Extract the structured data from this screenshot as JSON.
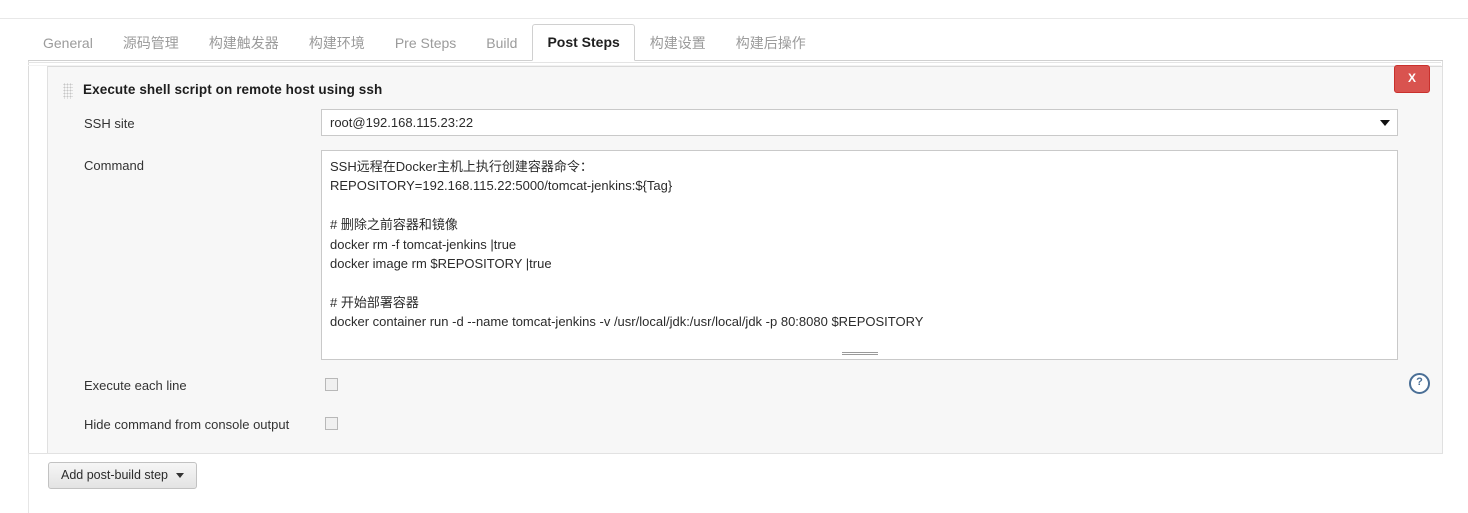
{
  "tabs": [
    {
      "label": "General",
      "active": false
    },
    {
      "label": "源码管理",
      "active": false
    },
    {
      "label": "构建触发器",
      "active": false
    },
    {
      "label": "构建环境",
      "active": false
    },
    {
      "label": "Pre Steps",
      "active": false
    },
    {
      "label": "Build",
      "active": false
    },
    {
      "label": "Post Steps",
      "active": true
    },
    {
      "label": "构建设置",
      "active": false
    },
    {
      "label": "构建后操作",
      "active": false
    }
  ],
  "step": {
    "title": "Execute shell script on remote host using ssh",
    "delete_label": "X",
    "drag_handle_icon": "drag-grip-icon",
    "help_icon": "help-circle-icon",
    "help_label": "?"
  },
  "fields": {
    "ssh_site": {
      "label": "SSH site",
      "value": "root@192.168.115.23:22",
      "caret_icon": "chevron-down-icon"
    },
    "command": {
      "label": "Command",
      "value": "SSH远程在Docker主机上执行创建容器命令：\nREPOSITORY=192.168.115.22:5000/tomcat-jenkins:${Tag}\n\n# 删除之前容器和镜像\ndocker rm -f tomcat-jenkins |true\ndocker image rm $REPOSITORY |true\n\n# 开始部署容器\ndocker container run -d --name tomcat-jenkins -v /usr/local/jdk:/usr/local/jdk -p 80:8080 $REPOSITORY"
    },
    "execute_each_line": {
      "label": "Execute each line",
      "checked": false
    },
    "hide_command": {
      "label": "Hide command from console output",
      "checked": false
    }
  },
  "footer": {
    "add_step_label": "Add post-build step",
    "caret_icon": "chevron-down-icon"
  },
  "colors": {
    "danger": "#d9534f",
    "panel_bg": "#f7f7f7",
    "help_blue": "#4a6f96"
  }
}
